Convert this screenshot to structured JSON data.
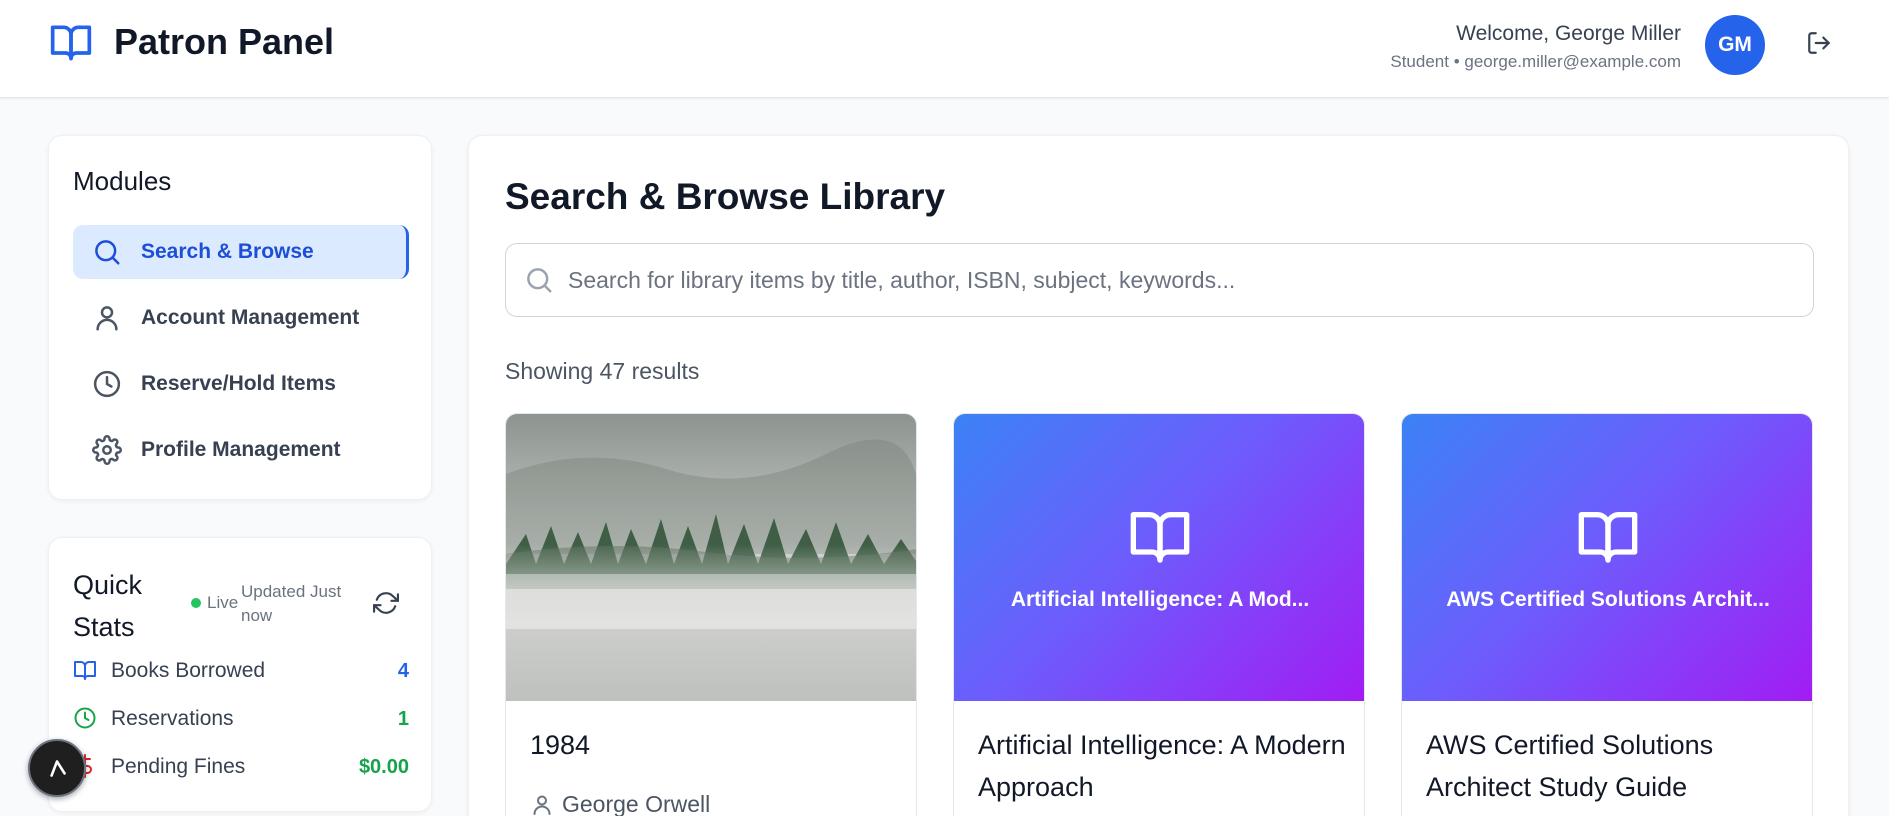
{
  "header": {
    "title": "Patron Panel",
    "welcome": "Welcome, George Miller",
    "user_meta": "Student • george.miller@example.com",
    "avatar_initials": "GM"
  },
  "colors": {
    "accent": "#2563eb",
    "active_bg": "#dbeafe",
    "green": "#16a34a",
    "red": "#dc2626",
    "cover_gradient": [
      "#3b82f6",
      "#a21cf4"
    ]
  },
  "sidebar": {
    "modules_title": "Modules",
    "items": [
      {
        "label": "Search & Browse",
        "icon": "search-icon",
        "active": true
      },
      {
        "label": "Account Management",
        "icon": "user-icon",
        "active": false
      },
      {
        "label": "Reserve/Hold Items",
        "icon": "clock-icon",
        "active": false
      },
      {
        "label": "Profile Management",
        "icon": "gear-icon",
        "active": false
      }
    ]
  },
  "quick_stats": {
    "title": "Quick Stats",
    "live_label": "Live",
    "updated_label": "Updated Just now",
    "rows": [
      {
        "label": "Books Borrowed",
        "value": "4",
        "icon": "book-icon",
        "color": "#2563eb"
      },
      {
        "label": "Reservations",
        "value": "1",
        "icon": "clock-icon",
        "color": "#16a34a"
      },
      {
        "label": "Pending Fines",
        "value": "$0.00",
        "icon": "dollar-icon",
        "color": "#16a34a"
      }
    ]
  },
  "main": {
    "title": "Search & Browse Library",
    "search_placeholder": "Search for library items by title, author, ISBN, subject, keywords...",
    "result_count": "Showing 47 results",
    "books": [
      {
        "title": "1984",
        "author": "George Orwell",
        "cover": "photo",
        "cover_label": ""
      },
      {
        "title": "Artificial Intelligence: A Modern Approach",
        "author": "",
        "cover": "gradient",
        "cover_label": "Artificial Intelligence: A Mod..."
      },
      {
        "title": "AWS Certified Solutions Architect Study Guide",
        "author": "",
        "cover": "gradient",
        "cover_label": "AWS Certified Solutions Archit..."
      }
    ]
  }
}
